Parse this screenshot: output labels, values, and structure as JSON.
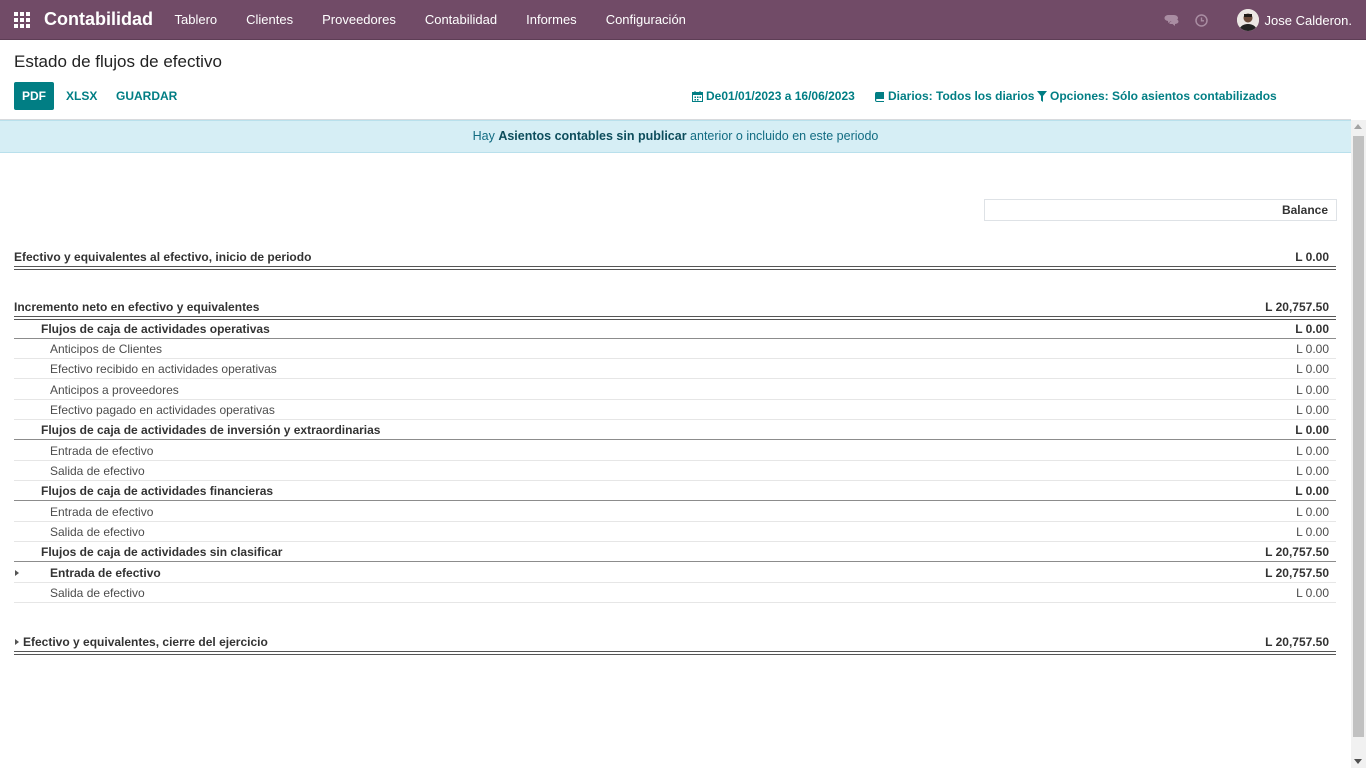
{
  "navbar": {
    "app_name": "Contabilidad",
    "menu": [
      "Tablero",
      "Clientes",
      "Proveedores",
      "Contabilidad",
      "Informes",
      "Configuración"
    ],
    "user_name": "Jose Calderon."
  },
  "control_panel": {
    "title": "Estado de flujos de efectivo",
    "buttons": {
      "pdf": "PDF",
      "xlsx": "XLSX",
      "save": "GUARDAR"
    },
    "filters": {
      "date": "De01/01/2023 a 16/06/2023",
      "journals": "Diarios: Todos los diarios",
      "options": "Opciones: Sólo asientos contabilizados"
    }
  },
  "alert": {
    "prefix": "Hay ",
    "link": "Asientos contables sin publicar",
    "suffix": " anterior o incluido en este periodo"
  },
  "report": {
    "column_header": "Balance",
    "lines": [
      {
        "label": "Efectivo y equivalentes al efectivo, inicio de periodo",
        "value": "L 0.00",
        "level": 0
      },
      {
        "label": "Incremento neto en efectivo y equivalentes",
        "value": "L 20,757.50",
        "level": 0
      },
      {
        "label": "Flujos de caja de actividades operativas",
        "value": "L 0.00",
        "level": 1
      },
      {
        "label": "Anticipos de Clientes",
        "value": "L 0.00",
        "level": 2
      },
      {
        "label": "Efectivo recibido en actividades operativas",
        "value": "L 0.00",
        "level": 2
      },
      {
        "label": "Anticipos a proveedores",
        "value": "L 0.00",
        "level": 2
      },
      {
        "label": "Efectivo pagado en actividades operativas",
        "value": "L 0.00",
        "level": 2
      },
      {
        "label": "Flujos de caja de actividades de inversión y extraordinarias",
        "value": "L 0.00",
        "level": 1
      },
      {
        "label": "Entrada de efectivo",
        "value": "L 0.00",
        "level": 2
      },
      {
        "label": "Salida de efectivo",
        "value": "L 0.00",
        "level": 2
      },
      {
        "label": "Flujos de caja de actividades financieras",
        "value": "L 0.00",
        "level": 1
      },
      {
        "label": "Entrada de efectivo",
        "value": "L 0.00",
        "level": 2
      },
      {
        "label": "Salida de efectivo",
        "value": "L 0.00",
        "level": 2
      },
      {
        "label": "Flujos de caja de actividades sin clasificar",
        "value": "L 20,757.50",
        "level": 1
      },
      {
        "label": "Entrada de efectivo",
        "value": "L 20,757.50",
        "level": 2,
        "expandable": true
      },
      {
        "label": "Salida de efectivo",
        "value": "L 0.00",
        "level": 2
      },
      {
        "label": "Efectivo y equivalentes, cierre del ejercicio",
        "value": "L 20,757.50",
        "level": 0,
        "expandable": true
      }
    ]
  },
  "colors": {
    "navbar": "#714b67",
    "accent": "#017e84",
    "alert_bg": "#d6eef5"
  },
  "icons": [
    "apps-grid-icon",
    "chat-icon",
    "clock-icon",
    "calendar-icon",
    "book-icon",
    "filter-icon",
    "caret-right-icon"
  ]
}
